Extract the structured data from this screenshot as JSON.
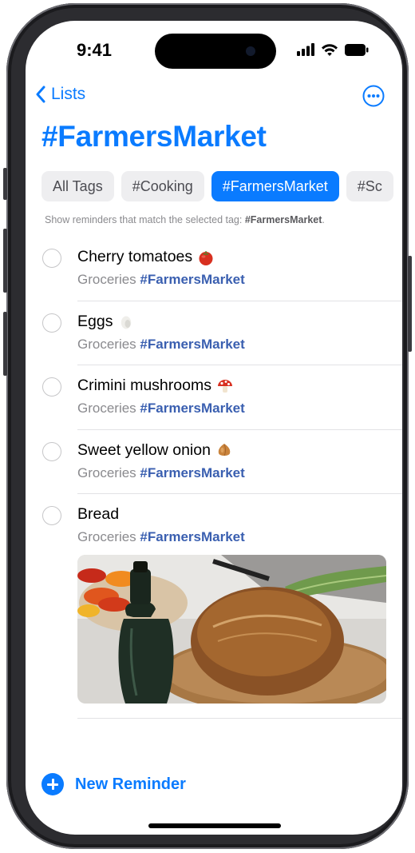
{
  "status_bar": {
    "time": "9:41"
  },
  "nav": {
    "back_label": "Lists"
  },
  "title": "#FarmersMarket",
  "tags": [
    "All Tags",
    "#Cooking",
    "#FarmersMarket",
    "#Sc"
  ],
  "selected_tag": "#FarmersMarket",
  "hint": {
    "prefix": "Show reminders that match the selected tag: ",
    "tag": "#FarmersMarket",
    "suffix": "."
  },
  "reminders": [
    {
      "title": "Cherry tomatoes",
      "icon": "tomato-emoji",
      "list": "Groceries",
      "tag": "#FarmersMarket"
    },
    {
      "title": "Eggs",
      "icon": "egg-emoji",
      "list": "Groceries",
      "tag": "#FarmersMarket"
    },
    {
      "title": "Crimini mushrooms",
      "icon": "mushroom-emoji",
      "list": "Groceries",
      "tag": "#FarmersMarket"
    },
    {
      "title": "Sweet yellow onion",
      "icon": "onion-emoji",
      "list": "Groceries",
      "tag": "#FarmersMarket"
    },
    {
      "title": "Bread",
      "icon": "",
      "list": "Groceries",
      "tag": "#FarmersMarket",
      "has_photo": true
    }
  ],
  "footer": {
    "new_reminder_label": "New Reminder"
  },
  "colors": {
    "accent": "#0a7bff",
    "tag_link": "#3a5fb0",
    "secondary_text": "#8a8a8e"
  }
}
